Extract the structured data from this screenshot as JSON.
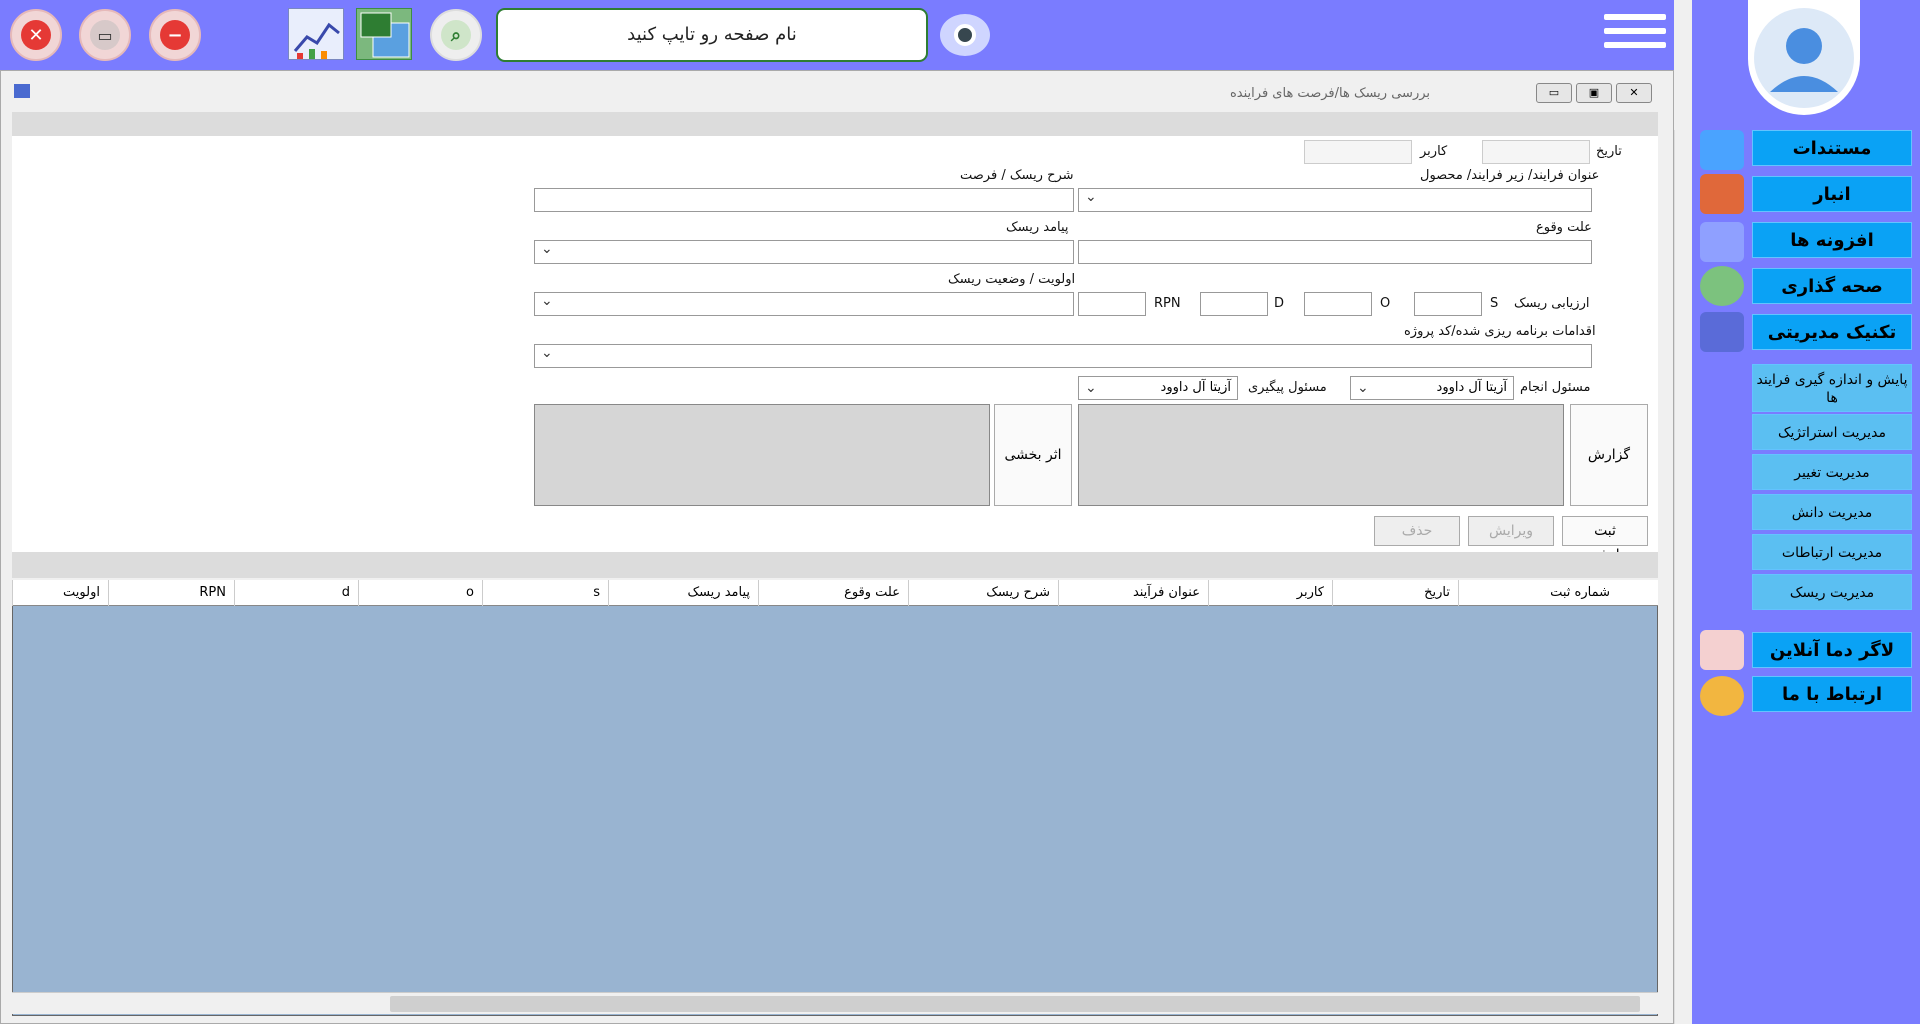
{
  "toolbar": {
    "search_placeholder": "نام صفحه رو تایپ کنید"
  },
  "window": {
    "title": "بررسی  ریسک  ها/فرصت های فراینده"
  },
  "form": {
    "date_label": "تاریخ",
    "user_label": "کاربر",
    "process_label": "عنوان فرایند/  زیر فرایند/ محصول",
    "risk_desc_label": "شرح ریسک / فرصت",
    "cause_label": "علت وقوع",
    "consequence_label": "پیامد ریسک",
    "eval_label": "ارزیابی ریسک",
    "s_label": "S",
    "o_label": "O",
    "d_label": "D",
    "rpn_label": "RPN",
    "priority_label": "اولویت / وضعیت ریسک",
    "actions_label": "اقدامات برنامه ریزی شده/کد پروژه",
    "responsible_label": "مسئول انجام",
    "responsible_value": "آزیتا  آل داوود",
    "follow_label": "مسئول پیگیری",
    "follow_value": "آزیتا  آل داوود",
    "monitor_btn": "گزارش پایش",
    "effect_btn": "اثر بخشی",
    "save_btn": "ثبت",
    "edit_btn": "ویرایش",
    "delete_btn": "حذف"
  },
  "grid": {
    "columns": [
      "شماره ثبت",
      "تاریخ",
      "کاربر",
      "عنوان فرآیند",
      "شرح ریسک",
      "علت وقوع",
      "پیامد ریسک",
      "s",
      "o",
      "d",
      "RPN",
      "اولویت"
    ]
  },
  "sidebar": {
    "main": [
      "مستندات",
      "انبار",
      "افزونه ها",
      "صحه گذاری",
      "تکنیک مدیریتی"
    ],
    "sub": [
      "پایش و اندازه گیری فرایند ها",
      "مدیریت استراتژیک",
      "مدیریت تغییر",
      "مدیریت دانش",
      "مدیریت ارتباطات",
      "مدیریت ریسک"
    ],
    "bottom": [
      "لاگر دما آنلاین",
      "ارتباط با ما"
    ]
  }
}
